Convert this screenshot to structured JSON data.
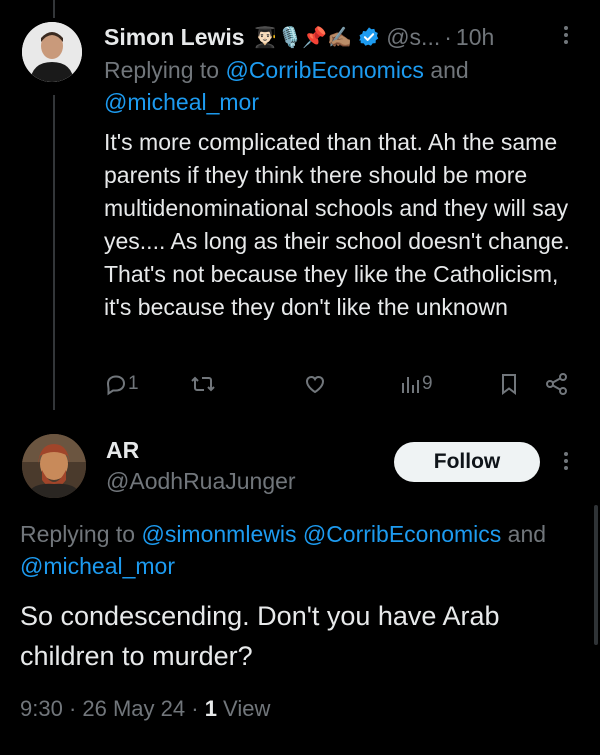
{
  "tweet1": {
    "author_name": "Simon Lewis",
    "emojis": "👨🏻‍🎓🎙️📌✍🏽",
    "handle": "@s...",
    "separator": "·",
    "time": "10h",
    "replying_prefix": "Replying to ",
    "replying_mention1": "@CorribEconomics",
    "replying_and": " and",
    "replying_mention2": "@micheal_mor",
    "text": "It's more complicated than that. Ah the same parents if they think there should be more multidenominational schools and they will say yes.... As long as their school doesn't change. That's not because they like the Catholicism, it's because they don't like the unknown",
    "actions": {
      "reply_count": "1",
      "retweet_count": "",
      "like_count": "",
      "views_count": "9"
    }
  },
  "tweet2": {
    "author_name": "AR",
    "handle": "@AodhRuaJunger",
    "follow_label": "Follow",
    "replying_prefix": "Replying to ",
    "replying_mention1": "@simonmlewis",
    "replying_mention2": " @CorribEconomics",
    "replying_and": " and",
    "replying_mention3": "@micheal_mor",
    "text": "So condescending. Don't you have Arab children to murder?",
    "time": "9:30",
    "dot": " · ",
    "date": "26 May 24",
    "views_count": "1",
    "views_label": " View"
  },
  "colors": {
    "background": "#000000",
    "text": "#e7e9ea",
    "secondary": "#71767b",
    "link": "#1d9bf0",
    "verified": "#1d9bf0"
  }
}
